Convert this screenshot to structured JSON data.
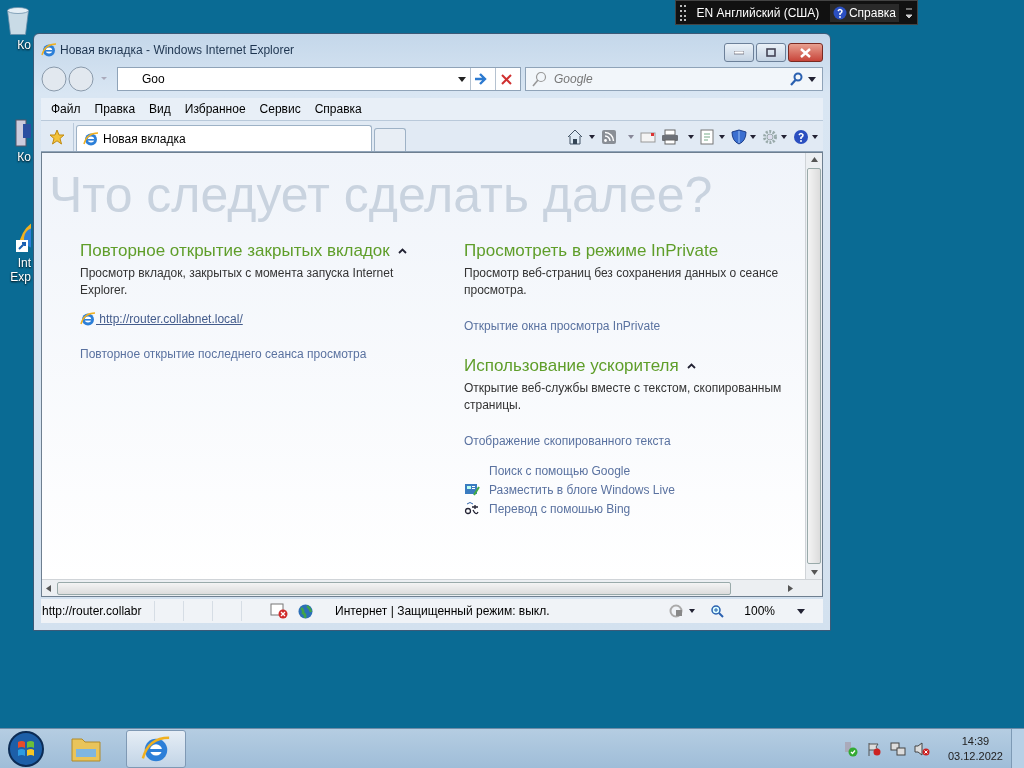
{
  "desktop_icons": [
    {
      "kind": "bin",
      "label_lines": [
        "Ко"
      ]
    },
    {
      "kind": "computer",
      "label_lines": [
        "Ко"
      ]
    },
    {
      "kind": "ie",
      "label_lines": [
        "Int",
        "Exp"
      ]
    }
  ],
  "language_bar": {
    "language": "EN Английский (США)",
    "help": "Справка"
  },
  "window": {
    "title": "Новая вкладка - Windows Internet Explorer",
    "address": {
      "value": "Goo"
    },
    "search": {
      "placeholder": "Google"
    },
    "menu": [
      "Файл",
      "Правка",
      "Вид",
      "Избранное",
      "Сервис",
      "Справка"
    ],
    "tabs": [
      {
        "label": "Новая вкладка",
        "selected": true
      }
    ],
    "page": {
      "watermark": "Что следует сделать далее?",
      "left": [
        {
          "heading": "Повторное открытие закрытых вкладок",
          "collapsible": true,
          "description": "Просмотр вкладок, закрытых с момента запуска Internet Explorer.",
          "recent": [
            "http://router.collabnet.local/"
          ],
          "links": [
            "Повторное открытие последнего сеанса просмотра"
          ]
        }
      ],
      "right": [
        {
          "heading": "Просмотреть в режиме InPrivate",
          "description_lines": [
            "Просмотр веб-страниц без сохранения данных о сеансе",
            "просмотра."
          ],
          "links": [
            "Открытие окна просмотра InPrivate"
          ]
        },
        {
          "heading": "Использование ускорителя",
          "collapsible": true,
          "description_lines": [
            "Открытие веб-службы вместе с текстом, скопированным",
            "страницы."
          ],
          "links": [
            "Отображение скопированного текста"
          ],
          "accelerators": [
            {
              "kind": "none",
              "label": "Поиск с помощью Google"
            },
            {
              "kind": "blog",
              "label": "Разместить в блоге Windows Live"
            },
            {
              "kind": "translate",
              "label": "Перевод с помошью Bing"
            }
          ]
        }
      ]
    },
    "status_bar": {
      "url": "http://router.collabr",
      "zone": "Интернет | Защищенный режим: выкл.",
      "zoom": "100%"
    }
  },
  "taskbar": {
    "buttons": [
      {
        "kind": "folder",
        "selected": false
      },
      {
        "kind": "ie",
        "selected": true
      }
    ],
    "time": "14:39",
    "date": "03.12.2022"
  }
}
